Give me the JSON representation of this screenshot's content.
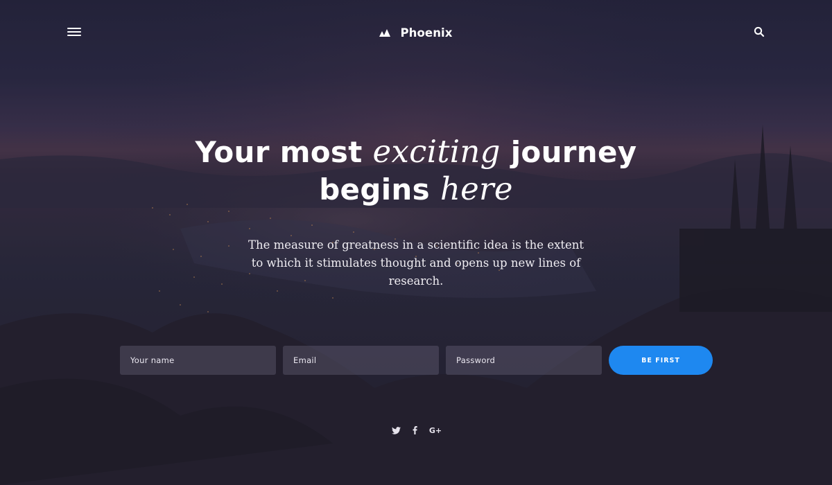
{
  "colors": {
    "accent": "#1e88f0",
    "overlay": "#2c2a44",
    "text": "#ffffff"
  },
  "header": {
    "menu_icon": "hamburger-menu-icon",
    "logo_icon": "mountain-peaks-icon",
    "brand_name": "Phoenix",
    "search_icon": "search-icon"
  },
  "hero": {
    "headline": {
      "part1": "Your most ",
      "emphasis1": "exciting",
      "part2": " journey",
      "part3": "begins ",
      "emphasis2": "here"
    },
    "subtitle": "The measure of greatness in a scientific idea is the extent to which it stimulates thought and opens up new lines of research."
  },
  "form": {
    "name_placeholder": "Your name",
    "email_placeholder": "Email",
    "password_placeholder": "Password",
    "submit_label": "BE FIRST"
  },
  "social": {
    "twitter_icon": "twitter-icon",
    "facebook_icon": "facebook-icon",
    "googleplus_icon": "google-plus-icon",
    "googleplus_text": "G+"
  }
}
